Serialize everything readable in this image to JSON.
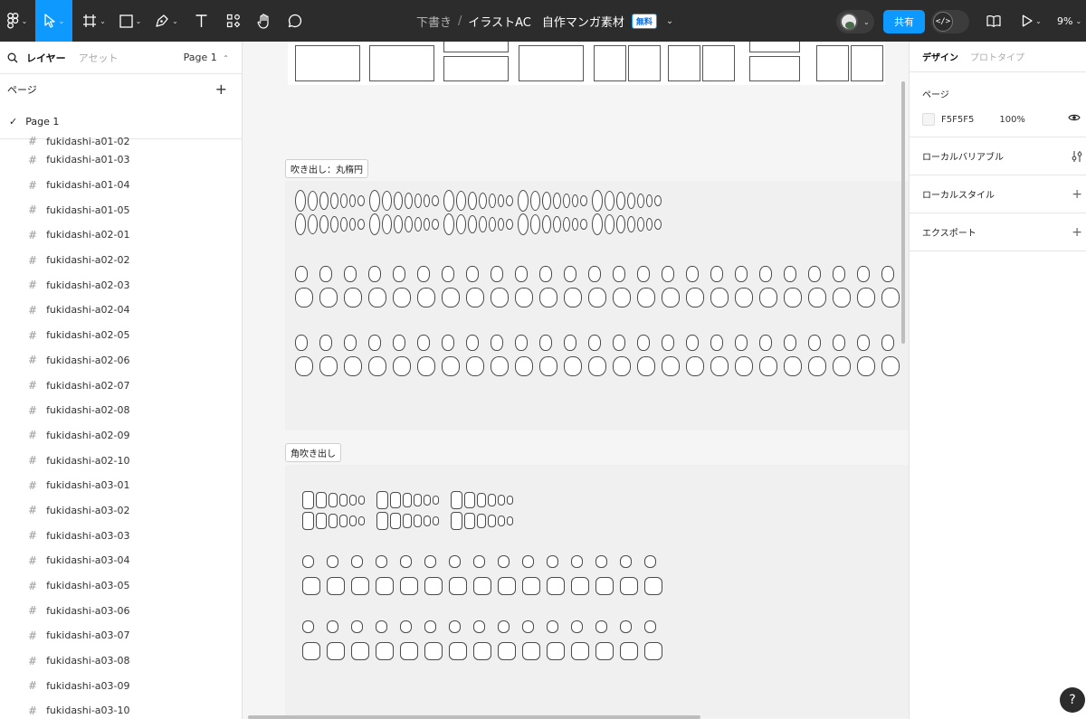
{
  "toolbar": {
    "zoom": "9%",
    "share_label": "共有",
    "dev_mode_label": "</>",
    "tools": [
      "main-menu",
      "move",
      "frame",
      "shape",
      "pen",
      "text",
      "resources",
      "hand",
      "comment"
    ]
  },
  "file": {
    "draft_label": "下書き",
    "separator": "/",
    "project": "イラストAC",
    "name": "自作マンガ素材",
    "plan_badge": "無料"
  },
  "left_panel": {
    "tab_layers": "レイヤー",
    "tab_assets": "アセット",
    "page_selector": "Page 1",
    "pages_heading": "ページ",
    "current_page": "Page 1",
    "layers_clipped": "fukidashi-a01-02",
    "layers": [
      "fukidashi-a01-03",
      "fukidashi-a01-04",
      "fukidashi-a01-05",
      "fukidashi-a02-01",
      "fukidashi-a02-02",
      "fukidashi-a02-03",
      "fukidashi-a02-04",
      "fukidashi-a02-05",
      "fukidashi-a02-06",
      "fukidashi-a02-07",
      "fukidashi-a02-08",
      "fukidashi-a02-09",
      "fukidashi-a02-10",
      "fukidashi-a03-01",
      "fukidashi-a03-02",
      "fukidashi-a03-03",
      "fukidashi-a03-04",
      "fukidashi-a03-05",
      "fukidashi-a03-06",
      "fukidashi-a03-07",
      "fukidashi-a03-08",
      "fukidashi-a03-09",
      "fukidashi-a03-10"
    ]
  },
  "canvas": {
    "section_round": "吹き出し：丸楕円",
    "section_square": "角吹き出し"
  },
  "right_panel": {
    "tab_design": "デザイン",
    "tab_prototype": "プロトタイプ",
    "page_heading": "ページ",
    "page_color": "F5F5F5",
    "page_opacity": "100%",
    "local_variables": "ローカルバリアブル",
    "local_styles": "ローカルスタイル",
    "export": "エクスポート"
  },
  "colors": {
    "toolbar_bg": "#2c2c2c",
    "accent": "#0d99ff",
    "canvas_bg": "#f5f5f5"
  },
  "help_label": "?"
}
